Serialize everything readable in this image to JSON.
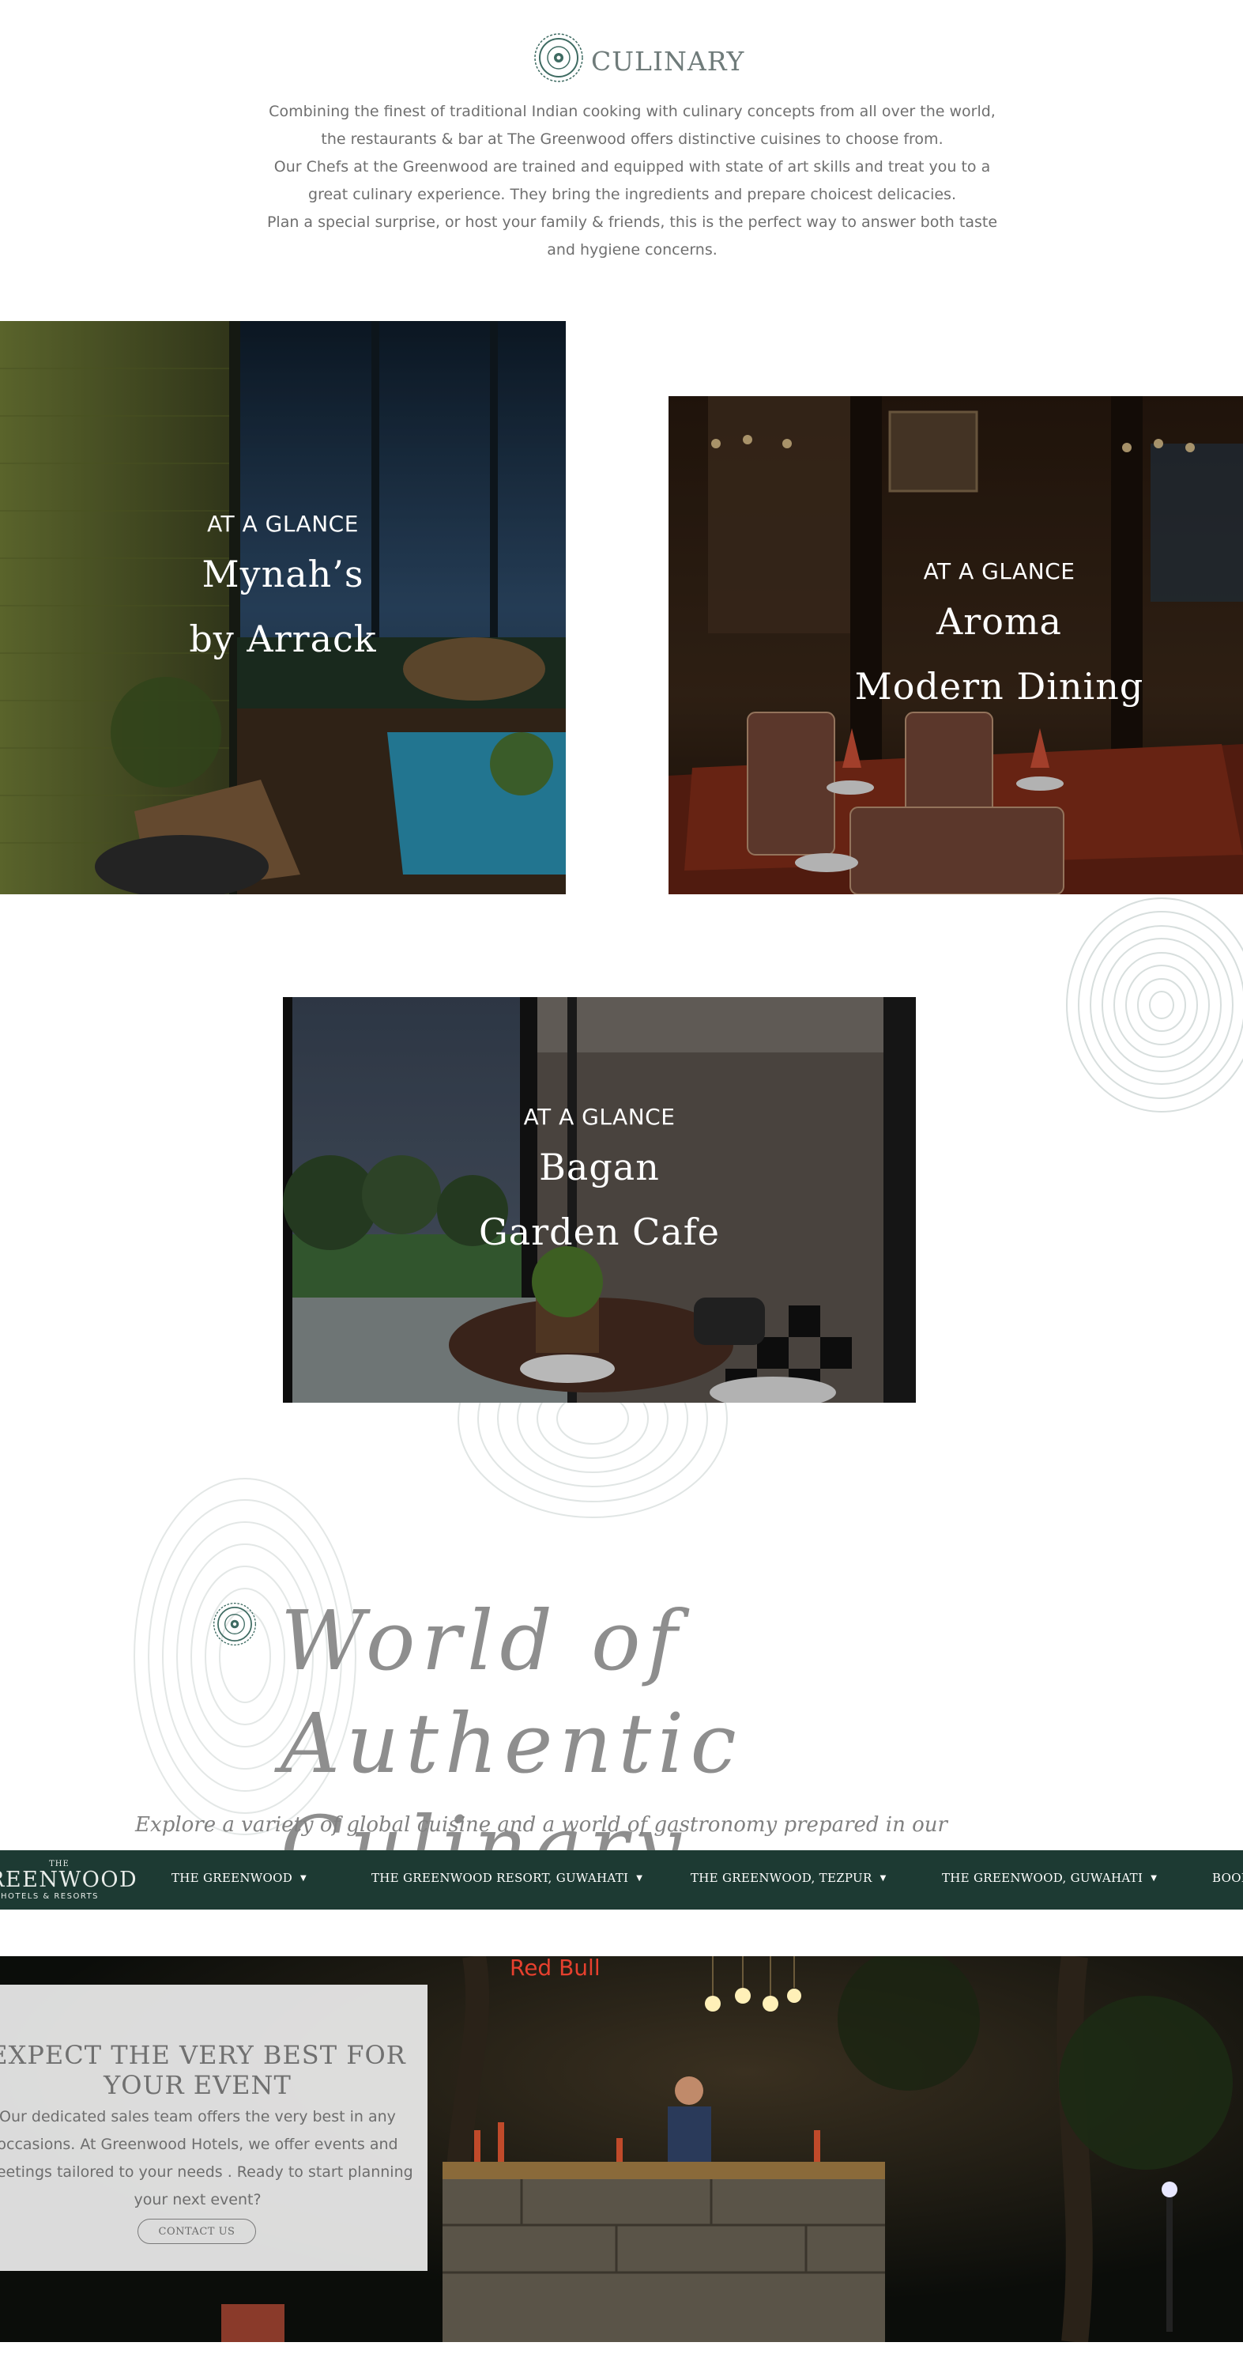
{
  "culinary": {
    "title": "CULINARY",
    "paragraphs": [
      "Combining the finest of traditional Indian cooking with culinary concepts from all over the world, the restaurants & bar at The Greenwood offers distinctive cuisines to choose from.",
      "Our Chefs at the Greenwood are trained and equipped with state of art skills and treat you to a great culinary experience. They bring the ingredients and prepare choicest delicacies.",
      "Plan a special surprise, or host your family & friends, this is the perfect way to answer both taste and hygiene concerns."
    ]
  },
  "restaurants": [
    {
      "eyebrow": "AT A GLANCE",
      "line1": "Mynah’s",
      "line2": "by Arrack"
    },
    {
      "eyebrow": "AT A GLANCE",
      "line1": "Aroma",
      "line2": "Modern Dining"
    },
    {
      "eyebrow": "AT A GLANCE",
      "line1": "Bagan",
      "line2": "Garden Cafe"
    }
  ],
  "world": {
    "heading_line1": "World of Authentic",
    "heading_line2": "Culinary",
    "description": "Explore a variety of global cuisine and a world of gastronomy prepared in our restaurants by our team of chefs."
  },
  "nav": {
    "brand_small": "THE",
    "brand_big": "GREENWOOD",
    "brand_sub": "HOTELS & RESORTS",
    "items": [
      "THE GREENWOOD",
      "THE GREENWOOD RESORT, GUWAHATI",
      "THE GREENWOOD, TEZPUR",
      "THE GREENWOOD, GUWAHATI",
      "BOOK"
    ]
  },
  "event": {
    "title": "EXPECT THE VERY BEST FOR YOUR EVENT",
    "body": "Our dedicated sales team offers the very best in any occasions. At Greenwood Hotels, we offer events and meetings tailored to your needs . Ready to start planning your next event?",
    "button": "CONTACT US",
    "sign_text": "Red Bull"
  },
  "colors": {
    "nav_bg": "#1d3a33",
    "logo_green": "#3e6b62",
    "text_grey": "#6f6f6f"
  }
}
